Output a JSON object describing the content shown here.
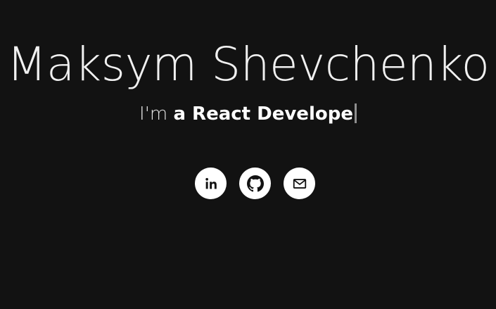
{
  "hero": {
    "name": "Maksym Shevchenko",
    "tagline_prefix": "I'm",
    "tagline_role": "a React Develope"
  },
  "socials": [
    {
      "icon": "linkedin-icon"
    },
    {
      "icon": "github-icon"
    },
    {
      "icon": "email-icon"
    }
  ],
  "colors": {
    "background": "#121212",
    "text": "#f0f0f0",
    "button": "#ffffff",
    "icon": "#121212",
    "cursor": "#8e8e8e"
  }
}
